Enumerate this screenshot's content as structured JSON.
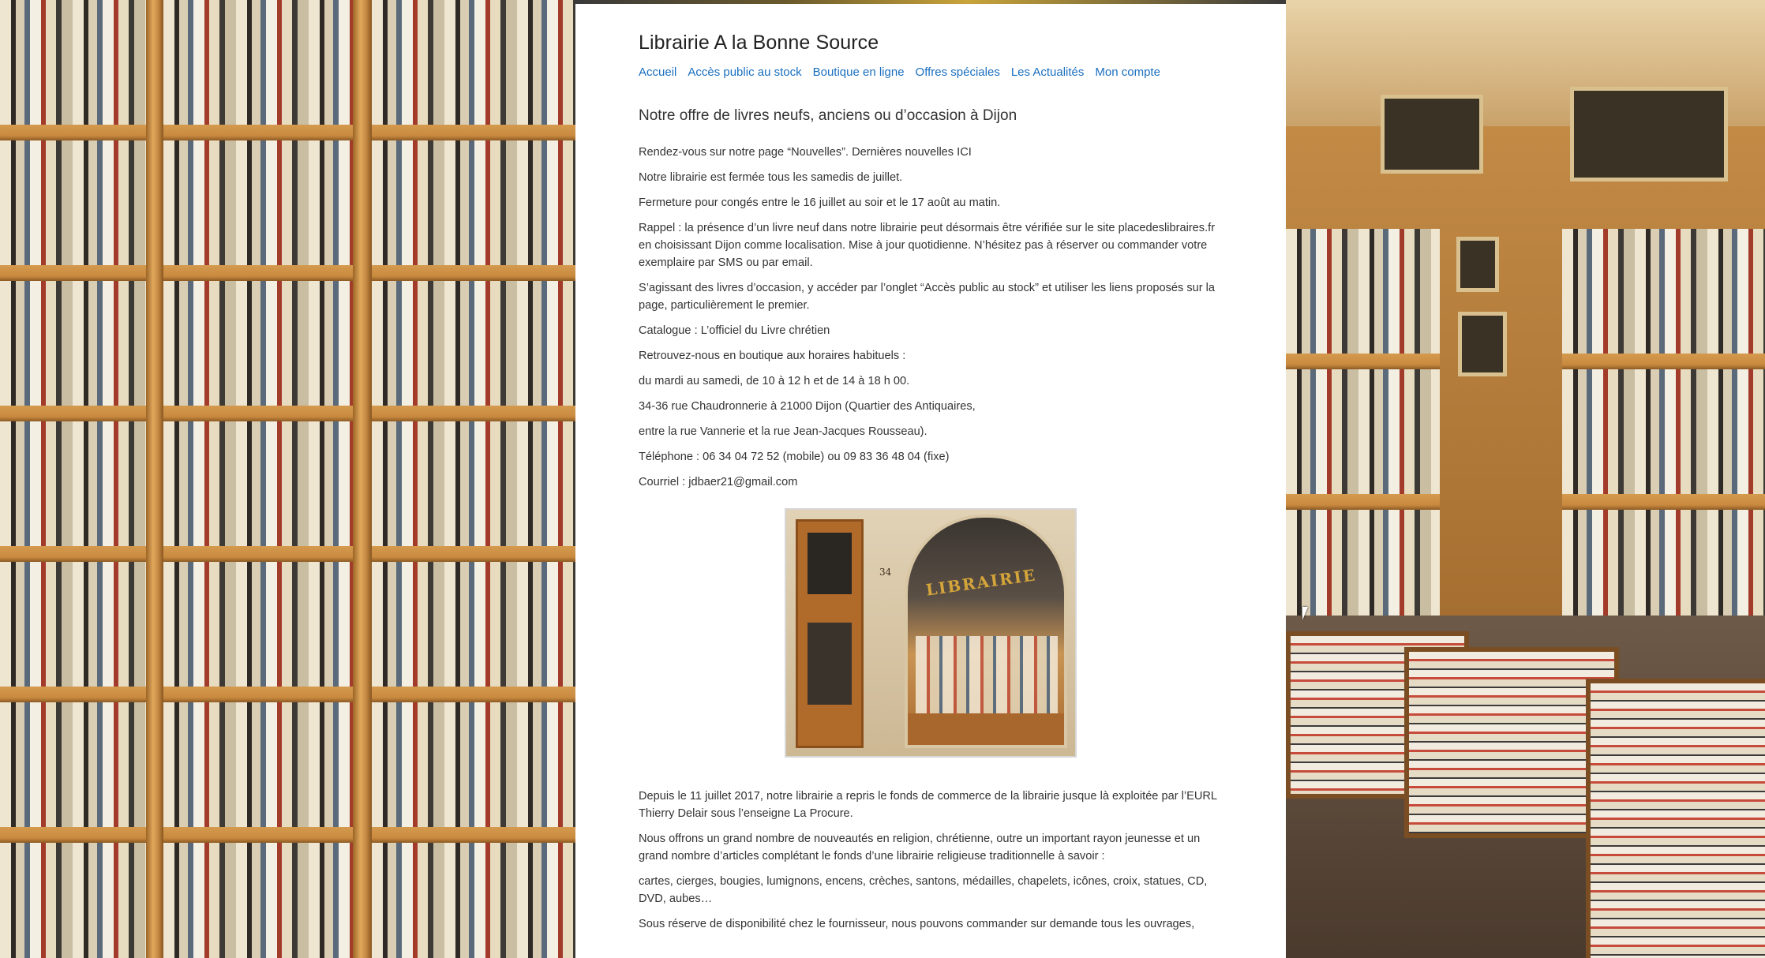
{
  "site": {
    "title": "Librairie A la Bonne Source"
  },
  "nav": {
    "items": [
      {
        "label": "Accueil"
      },
      {
        "label": "Accès public au stock"
      },
      {
        "label": "Boutique en ligne"
      },
      {
        "label": "Offres spéciales"
      },
      {
        "label": "Les Actualités"
      },
      {
        "label": "Mon compte"
      }
    ]
  },
  "main": {
    "heading": "Notre offre de livres neufs, anciens ou d’occasion à Dijon",
    "paragraphs": [
      "Rendez-vous sur notre page “Nouvelles”. Dernières nouvelles ICI",
      "Notre librairie est fermée tous les samedis de juillet.",
      "Fermeture pour congés entre le 16 juillet au soir et le 17 août au matin.",
      "Rappel : la présence d’un livre neuf dans notre librairie peut désormais être vérifiée sur le site placedesli­braires.fr en choisissant Dijon comme localisation. Mise à jour quotidienne. N’hésitez pas à réserver ou com­mander votre exemplaire par SMS ou par email.",
      "S’agissant des livres d’occasion, y accéder par l’onglet “Accès public au stock” et utiliser les liens proposés sur la page, particulièrement le premier.",
      "Catalogue : L’officiel du Livre chrétien",
      "Retrouvez-nous en boutique aux horaires habituels :",
      "du mardi au samedi, de 10 à 12 h et de 14 à 18 h 00.",
      "34-36 rue Chaudronnerie à 21000 Dijon (Quartier des Antiquaires,",
      "entre la rue Vannerie et la rue Jean-Jacques Rousseau).",
      "Téléphone : 06 34 04 72 52 (mobile) ou 09 83 36 48 04 (fixe)",
      "Courriel : jdbaer21@gmail.com"
    ],
    "photo": {
      "sign_text": "LIBRAIRIE",
      "house_number": "34"
    },
    "paragraphs_after": [
      "Depuis le 11 juillet 2017, notre librairie a repris le fonds de commerce de la librairie jusque là exploitée par l’EURL Thierry Delair sous l’enseigne La Procure.",
      "Nous offrons un grand nombre de nouveautés en religion, chrétienne, outre un important rayon jeunesse et un grand nombre d’articles complétant le fonds d’une librairie religieuse traditionnelle à savoir :",
      "cartes, cierges, bougies, lumignons, encens, crèches, santons, médailles, chapelets, icônes, croix, statues, CD, DVD, aubes…",
      "Sous réserve de disponibilité chez le fournisseur, nous pouvons commander sur demande tous les ouvrages,"
    ]
  },
  "colors": {
    "link": "#1a6fbf",
    "text": "#333333",
    "title": "#222222"
  }
}
